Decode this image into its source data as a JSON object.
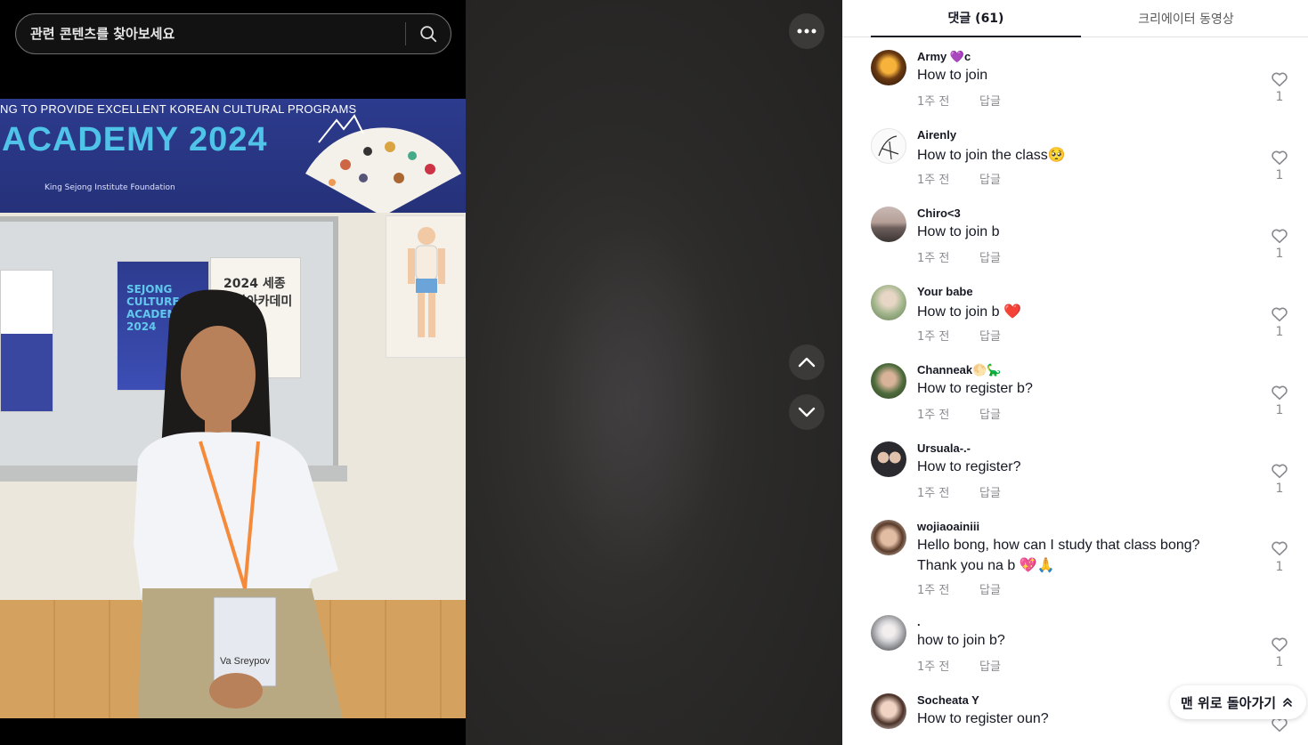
{
  "search": {
    "placeholder": "관련 콘텐츠를 찾아보세요"
  },
  "photo": {
    "banner_line1": "NG TO PROVIDE  EXCELLENT KOREAN CULTURAL PROGRAMS",
    "banner_line2": "ACADEMY 2024",
    "banner_logo_text": "King Sejong Institute Foundation",
    "poster_b_text": "SEJONG CULTURE ACADEMY 2024",
    "poster_c_text": "2024 세종문화아카데미",
    "name_tag": "Va Sreypov"
  },
  "tabs": {
    "comments": "댓글 (61)",
    "creator_videos": "크리에이터 동영상"
  },
  "comments": [
    {
      "user": "Army 💜c",
      "text": "How to join",
      "text2": "",
      "time": "1주 전",
      "reply": "답글",
      "likes": "1"
    },
    {
      "user": "Airenly",
      "text": "How to join the class🥺",
      "text2": "",
      "time": "1주 전",
      "reply": "답글",
      "likes": "1"
    },
    {
      "user": "Chiro<3",
      "text": "How to join b",
      "text2": "",
      "time": "1주 전",
      "reply": "답글",
      "likes": "1"
    },
    {
      "user": "Your babe",
      "text": "How to join b ❤️",
      "text2": "",
      "time": "1주 전",
      "reply": "답글",
      "likes": "1"
    },
    {
      "user": "Channeak🌕🦕",
      "text": "How to register b?",
      "text2": "",
      "time": "1주 전",
      "reply": "답글",
      "likes": "1"
    },
    {
      "user": "Ursuala-.-",
      "text": "How to register?",
      "text2": "",
      "time": "1주 전",
      "reply": "답글",
      "likes": "1"
    },
    {
      "user": "wojiaoainiii",
      "text": "Hello bong, how can I study that class bong?",
      "text2": "Thank you na b 💖🙏",
      "time": "1주 전",
      "reply": "답글",
      "likes": "1"
    },
    {
      "user": ".",
      "text": "how to join b?",
      "text2": "",
      "time": "1주 전",
      "reply": "답글",
      "likes": "1"
    },
    {
      "user": "Socheata Y",
      "text": "How to register oun?",
      "text2": "",
      "time": "",
      "reply": "",
      "likes": ""
    }
  ],
  "back_to_top": "맨 위로 돌아가기",
  "colors": {
    "accent_text": "#161823",
    "muted": "#8a8b91",
    "panel_bg": "#ffffff"
  },
  "icons": [
    "search-icon",
    "more-icon",
    "chevron-up-icon",
    "chevron-down-icon",
    "heart-icon",
    "double-chevron-up-icon"
  ]
}
